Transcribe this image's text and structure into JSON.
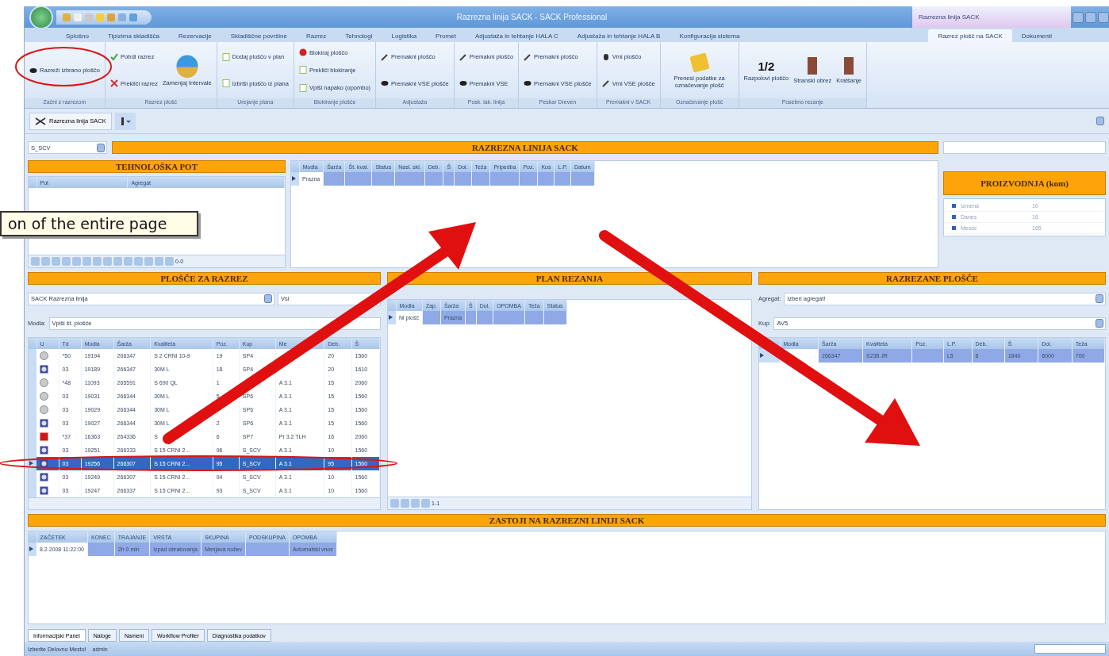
{
  "window": {
    "title": "Razrezna linija SACK - SACK Professional",
    "context_title": "Razrezna linija SACK"
  },
  "ribbon_tabs": [
    {
      "label": "Splošno",
      "selected": false
    },
    {
      "label": "Tipizirna skladišča",
      "selected": false
    },
    {
      "label": "Rezervacije",
      "selected": false
    },
    {
      "label": "Skladiščne površine",
      "selected": false
    },
    {
      "label": "Razrez",
      "selected": false
    },
    {
      "label": "Tehnologi",
      "selected": false
    },
    {
      "label": "Logistika",
      "selected": false
    },
    {
      "label": "Promet",
      "selected": false
    },
    {
      "label": "Adjustaža in tehtanje HALA C",
      "selected": false
    },
    {
      "label": "Adjustaža in tehtanje HALA B",
      "selected": false
    },
    {
      "label": "Konfiguracija sistema",
      "selected": false
    }
  ],
  "context_tabs": [
    {
      "label": "Razrez plošč na SACK",
      "selected": true
    },
    {
      "label": "Dokumenti",
      "selected": false
    }
  ],
  "ribbon_groups": [
    {
      "label": "Začni z razrezom",
      "buttons": [
        {
          "label": "Razreži izbrano ploščo",
          "kind": "brush"
        }
      ]
    },
    {
      "label": "Razrez plošč",
      "buttons": [
        {
          "label": "Potrdi razrez",
          "kind": "check"
        },
        {
          "label": "Prekliči razrez",
          "kind": "cross"
        },
        {
          "label": "Zamenjaj Intervale",
          "kind": "globe"
        }
      ]
    },
    {
      "label": "Urejanje plana",
      "buttons": [
        {
          "label": "Dodaj ploščo v plan",
          "kind": "doc"
        },
        {
          "label": "Izbriši ploščo iz plana",
          "kind": "doc"
        }
      ]
    },
    {
      "label": "Blokiranje plošče",
      "buttons": [
        {
          "label": "Blokiraj ploščo",
          "kind": "stop"
        },
        {
          "label": "Prekliči blokiranje",
          "kind": "doc"
        },
        {
          "label": "Vpiši napako (opombo)",
          "kind": "doc"
        }
      ]
    },
    {
      "label": "Adjustaža",
      "buttons": [
        {
          "label": "Premakni ploščo",
          "kind": "pencil"
        },
        {
          "label": "Premakni VSE plošče",
          "kind": "brush"
        }
      ]
    },
    {
      "label": "Posk. lak. linija",
      "buttons": [
        {
          "label": "Premakni ploščo",
          "kind": "pencil"
        },
        {
          "label": "Premakni VSE",
          "kind": "brush"
        }
      ]
    },
    {
      "label": "Peskar Dreven",
      "buttons": [
        {
          "label": "Premakni ploščo",
          "kind": "pencil"
        },
        {
          "label": "Premakni VSE plošče",
          "kind": "brush"
        }
      ]
    },
    {
      "label": "Premakni v SACK",
      "buttons": [
        {
          "label": "Vrni ploščo",
          "kind": "mouse"
        },
        {
          "label": "Vrni VSE plošče",
          "kind": "pencil"
        }
      ]
    },
    {
      "label": "Označevanje plošč",
      "buttons": [
        {
          "label": "Prenesi podatke za označevanje plošč",
          "kind": "note"
        }
      ]
    },
    {
      "label": "Posebno rezanje",
      "buttons": [
        {
          "label": "Razpolovi ploščo",
          "kind": "fraction",
          "glyph": "1/2"
        },
        {
          "label": "Stranski obrez",
          "kind": "bars"
        },
        {
          "label": "Kratšanje",
          "kind": "bars"
        }
      ]
    }
  ],
  "document_tab": {
    "label": "Razrezna linija SACK"
  },
  "line_selector": {
    "value": "S_SCV"
  },
  "line_banner": "RAZREZNA LINIJA SACK",
  "technology_path": {
    "title": "TEHNOLOŠKA POT",
    "columns": [
      "Pot",
      "Agregat"
    ],
    "pager": "0-0"
  },
  "line_grid": {
    "columns": [
      "Modla",
      "Šarža",
      "Št. kval.",
      "Status",
      "Nasl. skl.",
      "Deb.",
      "Š",
      "Dol.",
      "Teža",
      "Pripedba",
      "Poz.",
      "Kos",
      "L.P.",
      "Datum"
    ],
    "rows": [
      [
        "Prazna"
      ]
    ]
  },
  "production": {
    "title": "PROIZVODNJA (kom)",
    "rows": [
      {
        "label": "Izmena",
        "value": "10"
      },
      {
        "label": "Danes",
        "value": "16"
      },
      {
        "label": "Mesec",
        "value": "165"
      }
    ]
  },
  "plates_to_cut": {
    "title": "PLOŠČE ZA RAZREZ",
    "line": "SACK Razrezna linija",
    "filter": "Vsi",
    "modla_label": "Modla:",
    "modla_value": "Vpiši št. plošče",
    "columns": [
      "U",
      "Td",
      "Modla",
      "Šarža",
      "Kvaliteta",
      "Poz.",
      "Kup",
      "Me",
      "Deb.",
      "Š"
    ],
    "rows": [
      {
        "kind": "circle",
        "selected": false,
        "cells": [
          "",
          "*50",
          "19194",
          "266347",
          "S 2 CRNI 10-9",
          "19",
          "SP4",
          "",
          "20",
          "1560"
        ]
      },
      {
        "kind": "gear",
        "selected": false,
        "cells": [
          "",
          "03",
          "19189",
          "266347",
          "30M L",
          "18",
          "SP4",
          "",
          "20",
          "1610"
        ]
      },
      {
        "kind": "circle",
        "selected": false,
        "cells": [
          "",
          "*48",
          "11093",
          "265591",
          "S 690 QL",
          "1",
          "",
          "A 3.1",
          "15",
          "2060"
        ]
      },
      {
        "kind": "circle",
        "selected": false,
        "cells": [
          "",
          "03",
          "19031",
          "266344",
          "30M L",
          "5",
          "SP6",
          "A 3.1",
          "15",
          "1560"
        ]
      },
      {
        "kind": "circle",
        "selected": false,
        "cells": [
          "",
          "03",
          "19029",
          "266344",
          "30M L",
          "",
          "SP6",
          "A 3.1",
          "15",
          "1560"
        ]
      },
      {
        "kind": "gear",
        "selected": false,
        "cells": [
          "",
          "03",
          "19027",
          "266344",
          "30M L",
          "2",
          "SP6",
          "A 3.1",
          "15",
          "1560"
        ]
      },
      {
        "kind": "red",
        "selected": false,
        "cells": [
          "",
          "*37",
          "16363",
          "264336",
          "S",
          "6",
          "SP7",
          "Pr 3.2 TLH",
          "16",
          "2060"
        ]
      },
      {
        "kind": "gear",
        "selected": false,
        "cells": [
          "",
          "03",
          "19251",
          "266333",
          "S 15 CRNI 2...",
          "96",
          "S_SCV",
          "A 3.1",
          "10",
          "1560"
        ]
      },
      {
        "kind": "gear",
        "selected": true,
        "cells": [
          "",
          "03",
          "19256",
          "266307",
          "S 15 CRNI 2...",
          "95",
          "S_SCV",
          "A 3.1",
          "95",
          "1560"
        ]
      },
      {
        "kind": "gear",
        "selected": false,
        "cells": [
          "",
          "03",
          "19249",
          "266307",
          "S 15 CRNI 2...",
          "94",
          "S_SCV",
          "A 3.1",
          "10",
          "1560"
        ]
      },
      {
        "kind": "gear",
        "selected": false,
        "cells": [
          "",
          "03",
          "19247",
          "266337",
          "S 15 CRNI 2...",
          "93",
          "S_SCV",
          "A 3.1",
          "10",
          "1560"
        ]
      }
    ]
  },
  "cutting_plan": {
    "title": "PLAN REZANJA",
    "columns": [
      "Modla",
      "Zap.",
      "Šarža",
      "Š",
      "Dol.",
      "OPOMBA",
      "Teža",
      "Status"
    ],
    "rows": [
      [
        "Ni plošč",
        "",
        "Prazna",
        "",
        "",
        "",
        "",
        ""
      ]
    ],
    "pager": "1-1"
  },
  "cut_plates": {
    "title": "RAZREZANE PLOŠČE",
    "agregat_label": "Agregat:",
    "agregat_value": "Izberi agregat!",
    "kup_label": "Kup:",
    "kup_value": "AV5",
    "columns": [
      "Modla",
      "Šarža",
      "Kvaliteta",
      "Poz.",
      "L.P.",
      "Deb.",
      "Š",
      "Dol.",
      "Teža"
    ],
    "rows": [
      [
        "",
        "266347",
        "S235 JR",
        "",
        "L5",
        "8",
        "1840",
        "6000",
        "700"
      ]
    ]
  },
  "downtimes": {
    "title": "ZASTOJI NA RAZREZNI LINIJI SACK",
    "columns": [
      "ZAČETEK",
      "KONEC",
      "TRAJANJE",
      "VRSTA",
      "SKUPINA",
      "PODSKUPINA",
      "OPOMBA"
    ],
    "rows": [
      [
        "8.2.2008 11:22:00",
        "",
        "2h 0 min",
        "Izpad obratovanja",
        "Menjava nožev",
        "",
        "Avtomatski vnos"
      ]
    ]
  },
  "bottom_tabs": [
    {
      "label": "Informacijski Panel",
      "selected": true
    },
    {
      "label": "Naloge",
      "selected": false
    },
    {
      "label": "Nameni",
      "selected": false
    },
    {
      "label": "Workflow Profiler",
      "selected": false
    },
    {
      "label": "Diagnostika podatkov",
      "selected": false
    }
  ],
  "status_bar": {
    "workplace": "Izberite Delovno Mesto!",
    "user": "admin"
  },
  "tooltip": "on of the entire page"
}
